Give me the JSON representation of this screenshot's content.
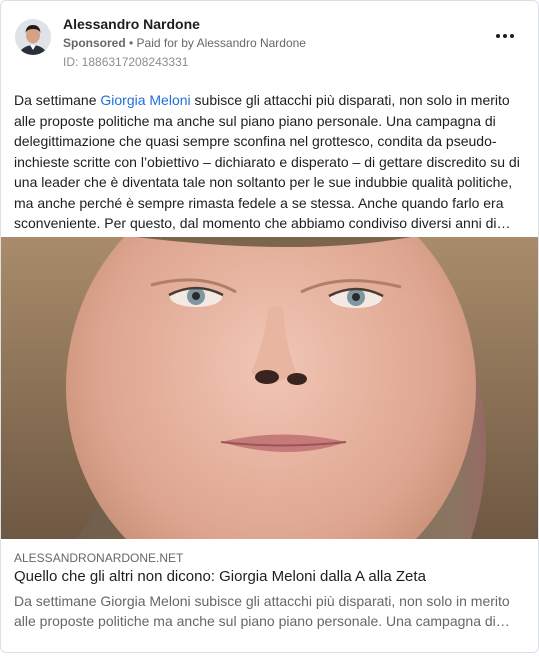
{
  "post": {
    "author": "Alessandro Nardone",
    "sponsored_label": "Sponsored",
    "paid_for": " • Paid for by Alessandro Nardone",
    "ad_id": "ID: 1886317208243331",
    "more_icon": "ellipsis-icon",
    "text_before_mention": "Da settimane ",
    "mention": "Giorgia Meloni",
    "text_after_mention": " subisce gli attacchi più disparati, non solo in merito alle proposte politiche ma anche sul piano piano personale. Una campagna di delegittimazione che quasi sempre sconfina nel grottesco, condita da pseudo-inchieste scritte con l’obiettivo – dichiarato e disperato – di gettare discredito su di una leader che è diventata tale non soltanto per le sue indubbie qualità politiche, ma anche perché è sempre rimasta fedele a se stessa. Anche quando farlo era sconveniente. Per questo, dal momento che abbiamo condiviso diversi anni di…"
  },
  "link_preview": {
    "domain": "ALESSANDRONARDONE.NET",
    "title": "Quello che gli altri non dicono: Giorgia Meloni dalla A alla Zeta",
    "description": "Da settimane Giorgia Meloni subisce gli attacchi più disparati, non solo in merito alle proposte politiche ma anche sul piano piano personale. Una campagna di…"
  },
  "colors": {
    "mention": "#216fdb",
    "text": "#1c1e21",
    "secondary": "#65676b"
  }
}
